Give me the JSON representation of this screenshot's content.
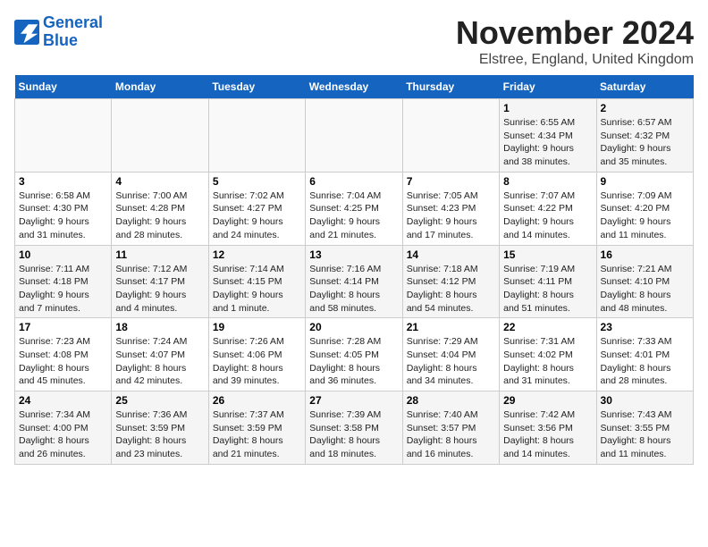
{
  "header": {
    "logo_line1": "General",
    "logo_line2": "Blue",
    "title": "November 2024",
    "subtitle": "Elstree, England, United Kingdom"
  },
  "weekdays": [
    "Sunday",
    "Monday",
    "Tuesday",
    "Wednesday",
    "Thursday",
    "Friday",
    "Saturday"
  ],
  "weeks": [
    [
      {
        "day": "",
        "info": ""
      },
      {
        "day": "",
        "info": ""
      },
      {
        "day": "",
        "info": ""
      },
      {
        "day": "",
        "info": ""
      },
      {
        "day": "",
        "info": ""
      },
      {
        "day": "1",
        "info": "Sunrise: 6:55 AM\nSunset: 4:34 PM\nDaylight: 9 hours\nand 38 minutes."
      },
      {
        "day": "2",
        "info": "Sunrise: 6:57 AM\nSunset: 4:32 PM\nDaylight: 9 hours\nand 35 minutes."
      }
    ],
    [
      {
        "day": "3",
        "info": "Sunrise: 6:58 AM\nSunset: 4:30 PM\nDaylight: 9 hours\nand 31 minutes."
      },
      {
        "day": "4",
        "info": "Sunrise: 7:00 AM\nSunset: 4:28 PM\nDaylight: 9 hours\nand 28 minutes."
      },
      {
        "day": "5",
        "info": "Sunrise: 7:02 AM\nSunset: 4:27 PM\nDaylight: 9 hours\nand 24 minutes."
      },
      {
        "day": "6",
        "info": "Sunrise: 7:04 AM\nSunset: 4:25 PM\nDaylight: 9 hours\nand 21 minutes."
      },
      {
        "day": "7",
        "info": "Sunrise: 7:05 AM\nSunset: 4:23 PM\nDaylight: 9 hours\nand 17 minutes."
      },
      {
        "day": "8",
        "info": "Sunrise: 7:07 AM\nSunset: 4:22 PM\nDaylight: 9 hours\nand 14 minutes."
      },
      {
        "day": "9",
        "info": "Sunrise: 7:09 AM\nSunset: 4:20 PM\nDaylight: 9 hours\nand 11 minutes."
      }
    ],
    [
      {
        "day": "10",
        "info": "Sunrise: 7:11 AM\nSunset: 4:18 PM\nDaylight: 9 hours\nand 7 minutes."
      },
      {
        "day": "11",
        "info": "Sunrise: 7:12 AM\nSunset: 4:17 PM\nDaylight: 9 hours\nand 4 minutes."
      },
      {
        "day": "12",
        "info": "Sunrise: 7:14 AM\nSunset: 4:15 PM\nDaylight: 9 hours\nand 1 minute."
      },
      {
        "day": "13",
        "info": "Sunrise: 7:16 AM\nSunset: 4:14 PM\nDaylight: 8 hours\nand 58 minutes."
      },
      {
        "day": "14",
        "info": "Sunrise: 7:18 AM\nSunset: 4:12 PM\nDaylight: 8 hours\nand 54 minutes."
      },
      {
        "day": "15",
        "info": "Sunrise: 7:19 AM\nSunset: 4:11 PM\nDaylight: 8 hours\nand 51 minutes."
      },
      {
        "day": "16",
        "info": "Sunrise: 7:21 AM\nSunset: 4:10 PM\nDaylight: 8 hours\nand 48 minutes."
      }
    ],
    [
      {
        "day": "17",
        "info": "Sunrise: 7:23 AM\nSunset: 4:08 PM\nDaylight: 8 hours\nand 45 minutes."
      },
      {
        "day": "18",
        "info": "Sunrise: 7:24 AM\nSunset: 4:07 PM\nDaylight: 8 hours\nand 42 minutes."
      },
      {
        "day": "19",
        "info": "Sunrise: 7:26 AM\nSunset: 4:06 PM\nDaylight: 8 hours\nand 39 minutes."
      },
      {
        "day": "20",
        "info": "Sunrise: 7:28 AM\nSunset: 4:05 PM\nDaylight: 8 hours\nand 36 minutes."
      },
      {
        "day": "21",
        "info": "Sunrise: 7:29 AM\nSunset: 4:04 PM\nDaylight: 8 hours\nand 34 minutes."
      },
      {
        "day": "22",
        "info": "Sunrise: 7:31 AM\nSunset: 4:02 PM\nDaylight: 8 hours\nand 31 minutes."
      },
      {
        "day": "23",
        "info": "Sunrise: 7:33 AM\nSunset: 4:01 PM\nDaylight: 8 hours\nand 28 minutes."
      }
    ],
    [
      {
        "day": "24",
        "info": "Sunrise: 7:34 AM\nSunset: 4:00 PM\nDaylight: 8 hours\nand 26 minutes."
      },
      {
        "day": "25",
        "info": "Sunrise: 7:36 AM\nSunset: 3:59 PM\nDaylight: 8 hours\nand 23 minutes."
      },
      {
        "day": "26",
        "info": "Sunrise: 7:37 AM\nSunset: 3:59 PM\nDaylight: 8 hours\nand 21 minutes."
      },
      {
        "day": "27",
        "info": "Sunrise: 7:39 AM\nSunset: 3:58 PM\nDaylight: 8 hours\nand 18 minutes."
      },
      {
        "day": "28",
        "info": "Sunrise: 7:40 AM\nSunset: 3:57 PM\nDaylight: 8 hours\nand 16 minutes."
      },
      {
        "day": "29",
        "info": "Sunrise: 7:42 AM\nSunset: 3:56 PM\nDaylight: 8 hours\nand 14 minutes."
      },
      {
        "day": "30",
        "info": "Sunrise: 7:43 AM\nSunset: 3:55 PM\nDaylight: 8 hours\nand 11 minutes."
      }
    ]
  ]
}
